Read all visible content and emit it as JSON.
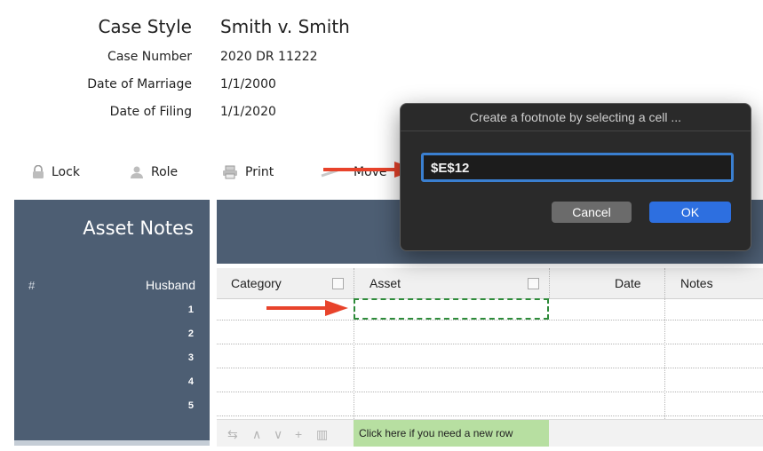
{
  "case": {
    "style_label": "Case Style",
    "style_value": "Smith v. Smith",
    "number_label": "Case Number",
    "number_value": "2020 DR 11222",
    "marriage_label": "Date of Marriage",
    "marriage_value": "1/1/2000",
    "filing_label": "Date of Filing",
    "filing_value": "1/1/2020"
  },
  "toolbar": {
    "lock": "Lock",
    "role": "Role",
    "print": "Print",
    "move": "Move"
  },
  "left_panel": {
    "title": "Asset Notes",
    "hash": "#",
    "husband": "Husband",
    "rows": [
      "1",
      "2",
      "3",
      "4",
      "5"
    ]
  },
  "table": {
    "headers": {
      "category": "Category",
      "asset": "Asset",
      "date": "Date",
      "notes": "Notes"
    },
    "new_row": "Click here if you need a new row"
  },
  "dialog": {
    "title": "Create a footnote by selecting a cell ...",
    "input_value": "$E$12",
    "cancel": "Cancel",
    "ok": "OK"
  },
  "colors": {
    "panel": "#4d5e73",
    "accent": "#2d6fe0",
    "arrow": "#e8432b",
    "selection": "#2e8b3a"
  }
}
